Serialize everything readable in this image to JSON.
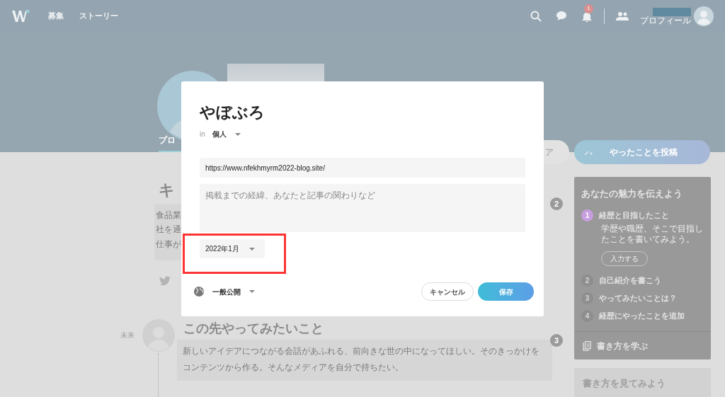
{
  "header": {
    "nav": [
      "募集",
      "ストーリー"
    ],
    "notification_count": "1",
    "profile_label": "プロフィール"
  },
  "profile": {
    "tab_partial": "プロ",
    "share_button_partial": "ア",
    "post_button": "やったことを投稿"
  },
  "career": {
    "step": "2",
    "heading": "キ",
    "lines": [
      "食品業",
      "社を通",
      "仕事が"
    ]
  },
  "future": {
    "step": "3",
    "label": "未来",
    "heading": "この先やってみたいこと",
    "text": "新しいアイデアにつながる会話があふれる、前向きな世の中になってほしい。そのきっかけをコンテンツから作る。そんなメディアを自分で持ちたい。"
  },
  "guide": {
    "title": "あなたの魅力を伝えよう",
    "steps": [
      {
        "number": "1",
        "title": "経歴と目指したこと",
        "description": "学歴や職歴、そこで目指したことを書いてみよう。",
        "button": "入力する",
        "selected": true
      },
      {
        "number": "2",
        "title": "自己紹介を書こう",
        "selected": false
      },
      {
        "number": "3",
        "title": "やってみたいことは？",
        "selected": false
      },
      {
        "number": "4",
        "title": "経歴にやったことを追加",
        "selected": false
      }
    ],
    "learn_link": "書き方を学ぶ"
  },
  "examples_card": {
    "title": "書き方を見てみよう"
  },
  "dialog": {
    "title": "やぼぶろ",
    "in_label": "in",
    "category": "個人",
    "url": "https://www.nfekhmyrm2022-blog.site/",
    "description_placeholder": "掲載までの経緯、あなたと記事の関わりなど",
    "date": "2022年1月",
    "visibility": "一般公開",
    "buttons": [
      {
        "kind": "secondary",
        "label": "キャンセル"
      },
      {
        "kind": "primary",
        "label": "保存"
      }
    ]
  }
}
